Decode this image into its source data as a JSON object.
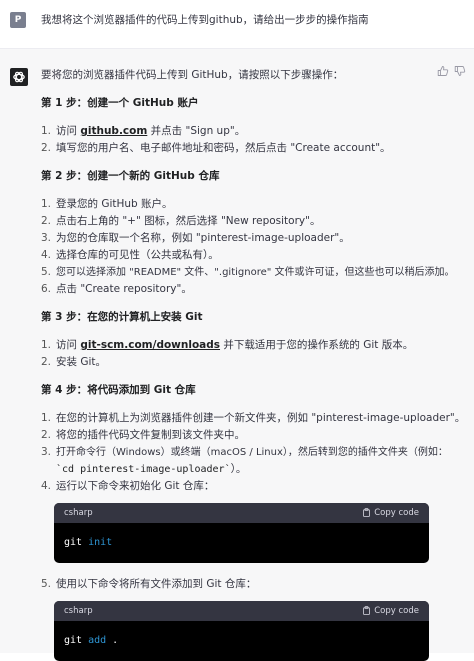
{
  "user": {
    "avatar_letter": "P",
    "message": "我想将这个浏览器插件的代码上传到github，请给出一步步的操作指南"
  },
  "assistant": {
    "intro": "要将您的浏览器插件代码上传到 GitHub，请按照以下步骤操作：",
    "step1": {
      "title": "第 1 步：创建一个 GitHub 账户",
      "items": [
        {
          "n": "1.",
          "pre": "访问 ",
          "link": "github.com",
          "post": " 并点击 \"Sign up\"。"
        },
        {
          "n": "2.",
          "text": "填写您的用户名、电子邮件地址和密码，然后点击 \"Create account\"。"
        }
      ]
    },
    "step2": {
      "title": "第 2 步：创建一个新的 GitHub 仓库",
      "items": [
        {
          "n": "1.",
          "text": "登录您的 GitHub 账户。"
        },
        {
          "n": "2.",
          "text": "点击右上角的 \"+\" 图标，然后选择 \"New repository\"。"
        },
        {
          "n": "3.",
          "text": "为您的仓库取一个名称，例如 \"pinterest-image-uploader\"。"
        },
        {
          "n": "4.",
          "text": "选择仓库的可见性（公共或私有）。"
        },
        {
          "n": "5.",
          "text": "您可以选择添加 \"README\" 文件、\".gitignore\" 文件或许可证，但这些也可以稍后添加。"
        },
        {
          "n": "6.",
          "text": "点击 \"Create repository\"。"
        }
      ]
    },
    "step3": {
      "title": "第 3 步：在您的计算机上安装 Git",
      "items": [
        {
          "n": "1.",
          "pre": "访问 ",
          "link": "git-scm.com/downloads",
          "post": " 并下载适用于您的操作系统的 Git 版本。"
        },
        {
          "n": "2.",
          "text": "安装 Git。"
        }
      ]
    },
    "step4": {
      "title": "第 4 步：将代码添加到 Git 仓库",
      "items": [
        {
          "n": "1.",
          "text": "在您的计算机上为浏览器插件创建一个新文件夹，例如 \"pinterest-image-uploader\"。"
        },
        {
          "n": "2.",
          "text": "将您的插件代码文件复制到该文件夹中。"
        },
        {
          "n": "3.",
          "text": "打开命令行（Windows）或终端（macOS / Linux），然后转到您的插件文件夹（例如：",
          "cont_code": "`cd pinterest-image-uploader`",
          "cont_post": "）。"
        },
        {
          "n": "4.",
          "text": "运行以下命令来初始化 Git 仓库："
        },
        {
          "n": "5.",
          "text": "使用以下命令将所有文件添加到 Git 仓库："
        }
      ],
      "code1": {
        "lang": "csharp",
        "copy": "Copy code",
        "cmd": "git",
        "arg": "init"
      },
      "code2": {
        "lang": "csharp",
        "copy": "Copy code",
        "cmd": "git",
        "arg": "add",
        "rest": " ."
      }
    }
  },
  "colors": {
    "user_bg": "#ffffff",
    "assistant_bg": "#f7f7f8",
    "code_bg": "#000000",
    "code_header": "#343541",
    "keyword": "#2e95d3"
  }
}
